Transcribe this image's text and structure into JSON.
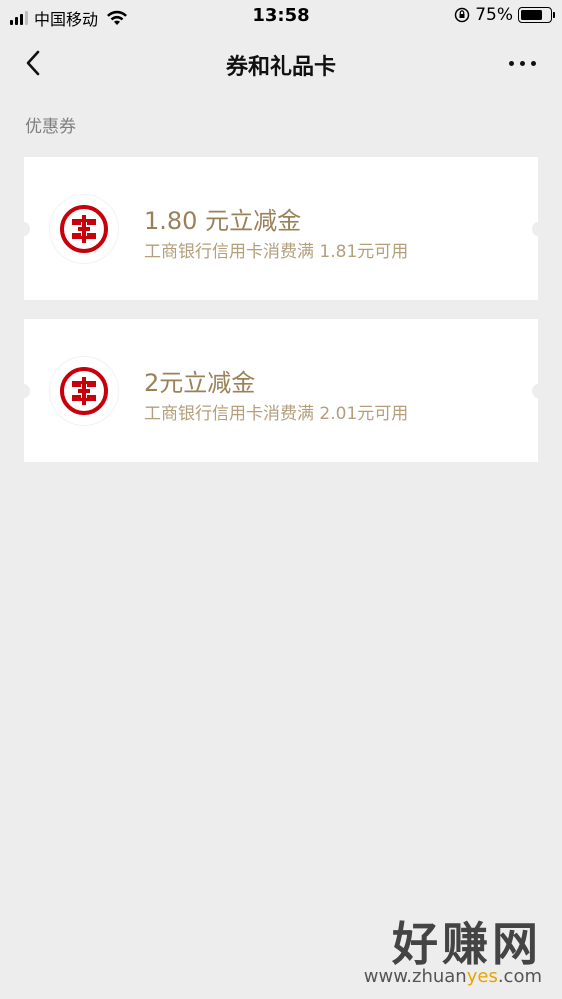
{
  "status_bar": {
    "carrier": "中国移动",
    "time": "13:58",
    "battery": "75%",
    "battery_level": 0.75
  },
  "nav": {
    "title": "券和礼品卡",
    "back_icon": "chevron-left-icon",
    "more_icon": "more-dots-icon"
  },
  "section": {
    "label": "优惠券"
  },
  "coupons": [
    {
      "title": "1.80 元立减金",
      "desc": "工商银行信用卡消费满 1.81元可用",
      "logo": "icbc-logo-icon"
    },
    {
      "title": "2元立减金",
      "desc": "工商银行信用卡消费满 2.01元可用",
      "logo": "icbc-logo-icon"
    }
  ],
  "watermark": {
    "main": "好赚网",
    "url_pre": "www.zhuan",
    "url_accent": "yes",
    "url_post": ".com"
  },
  "colors": {
    "background": "#ededed",
    "coupon_title": "#9a8157",
    "coupon_desc": "#b39f7c",
    "icbc_red": "#c7000b"
  }
}
